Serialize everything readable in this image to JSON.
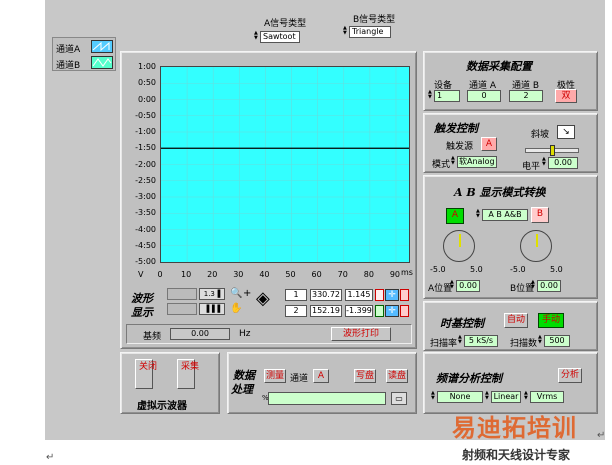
{
  "header": {
    "a_type_label": "A信号类型",
    "a_type_value": "Sawtoot",
    "b_type_label": "B信号类型",
    "b_type_value": "Triangle"
  },
  "legend": {
    "channel_a": "通道A",
    "channel_b": "通道B"
  },
  "graph": {
    "y_ticks": [
      "1:00",
      "0:50",
      "0:00",
      "-0:50",
      "-1:00",
      "-1:50",
      "-2:00",
      "-2:50",
      "-3:00",
      "-3:50",
      "-4:00",
      "-4:50",
      "-5:00"
    ],
    "x_ticks": [
      "0",
      "10",
      "20",
      "30",
      "40",
      "50",
      "60",
      "70",
      "80",
      "90"
    ],
    "x_unit": "ms",
    "y_axis_label": "V",
    "trace_level": -1.5
  },
  "chart_data": {
    "type": "line",
    "x": [
      0,
      95
    ],
    "series": [
      {
        "values": [
          -1.5,
          -1.5
        ]
      }
    ],
    "xlabel": "ms",
    "ylabel": "V",
    "xlim": [
      0,
      95
    ],
    "ylim": [
      -5.0,
      1.0
    ],
    "grid": true
  },
  "waveform": {
    "label_line1": "波形",
    "label_line2": "显示",
    "row1_index": "1",
    "row1_x": "330.72",
    "row1_y": "1.145",
    "row2_index": "2",
    "row2_x": "152.19",
    "row2_y": "-1.399",
    "freq_label": "基频",
    "freq_value": "0.00",
    "freq_unit": "Hz",
    "print_button": "波形打印"
  },
  "daq": {
    "title": "数据采集配置",
    "device_label": "设备",
    "device_value": "1",
    "cha_label": "通道 A",
    "cha_value": "0",
    "chb_label": "通道 B",
    "chb_value": "2",
    "polarity_label": "极性",
    "polarity_value": "双"
  },
  "trigger": {
    "title": "触发控制",
    "source_label": "触发源",
    "source_value": "A",
    "slope_label": "斜坡",
    "mode_label": "模式",
    "mode_value": "软Analog",
    "level_label": "电平",
    "level_value": "0.00"
  },
  "ab_mode": {
    "title": "A B 显示模式转换",
    "a_button": "A",
    "mode_value": "A B A&B",
    "b_button": "B",
    "a_min": "-5.0",
    "a_max": "5.0",
    "b_min": "-5.0",
    "b_max": "5.0",
    "a_pos_label": "A位置",
    "a_pos_value": "0.00",
    "b_pos_label": "B位置",
    "b_pos_value": "0.00"
  },
  "timebase": {
    "title": "时基控制",
    "auto_button": "自动",
    "manual_button": "手动",
    "rate_label": "扫描率",
    "rate_value": "5 kS/s",
    "count_label": "扫描数",
    "count_value": "500"
  },
  "bottom": {
    "close_button": "关闭",
    "acquire_button": "采集",
    "app_title": "虚拟示波器",
    "dp_title_1": "数据",
    "dp_title_2": "处理",
    "measure_button": "测量",
    "channel_label": "通道",
    "channel_value": "A",
    "write_button": "写盘",
    "read_button": "读盘",
    "path_prefix": "%"
  },
  "spectrum": {
    "title": "频谱分析控制",
    "analyze_button": "分析",
    "window_value": "None",
    "scale_value": "Linear",
    "unit_value": "Vrms"
  },
  "watermark": {
    "brand": "易迪拓培训",
    "subtitle": "射频和天线设计专家"
  },
  "colors": {
    "graph_bg": "#33ffff",
    "trace": "#000000",
    "led_green": "#00dd00",
    "button_text": "#d00000",
    "watermark": "#e35a1a"
  }
}
